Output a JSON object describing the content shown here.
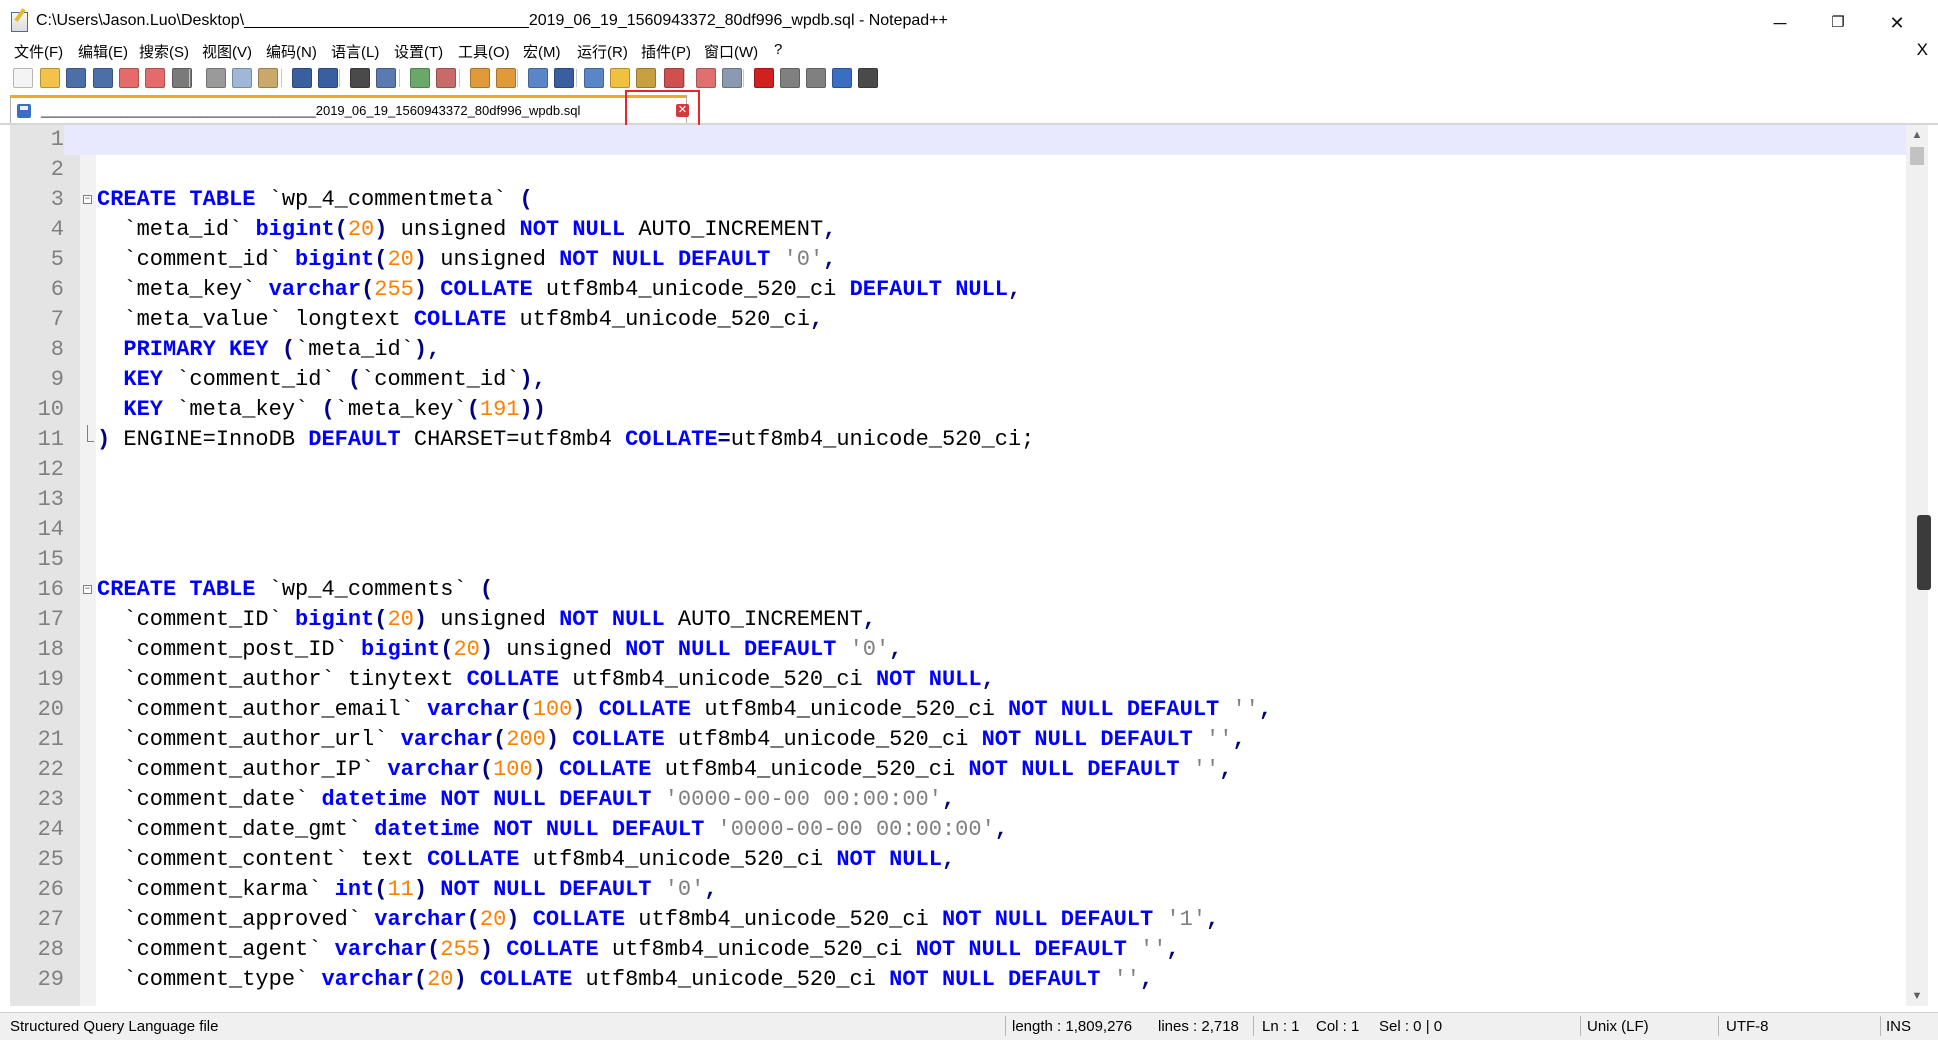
{
  "window": {
    "title": "C:\\Users\\Jason.Luo\\Desktop\\________________________________2019_06_19_1560943372_80df996_wpdb.sql - Notepad++",
    "minimize": "─",
    "restore": "❐",
    "close": "✕"
  },
  "menu": {
    "items": [
      "文件(F)",
      "编辑(E)",
      "搜索(S)",
      "视图(V)",
      "编码(N)",
      "语言(L)",
      "设置(T)",
      "工具(O)",
      "宏(M)",
      "运行(R)",
      "插件(P)",
      "窗口(W)",
      "?"
    ],
    "close": "X"
  },
  "toolbar": {
    "icons": [
      "new-file-icon",
      "open-file-icon",
      "save-icon",
      "save-all-icon",
      "close-icon",
      "close-all-icon",
      "print-icon",
      "cut-icon",
      "copy-icon",
      "paste-icon",
      "undo-icon",
      "redo-icon",
      "find-icon",
      "replace-icon",
      "zoom-in-icon",
      "zoom-out-icon",
      "sync-v-icon",
      "sync-h-icon",
      "word-wrap-icon",
      "show-all-chars-icon",
      "indent-guide-icon",
      "udl-icon",
      "doc-map-icon",
      "function-list-icon",
      "folder-workspace-icon",
      "monitor-icon",
      "record-macro-icon",
      "stop-macro-icon",
      "play-macro-icon",
      "run-macro-multiple-icon",
      "save-macro-icon"
    ]
  },
  "tab": {
    "label": "______________________________________2019_06_19_1560943372_80df996_wpdb.sql",
    "close": "✕"
  },
  "editor": {
    "current_line": 1,
    "lines": [
      {
        "n": "1",
        "tokens": []
      },
      {
        "n": "2",
        "tokens": []
      },
      {
        "n": "3",
        "fold": "start",
        "tokens": [
          [
            "kw",
            "CREATE"
          ],
          [
            "p",
            " "
          ],
          [
            "kw",
            "TABLE"
          ],
          [
            "p",
            " `wp_4_commentmeta` "
          ],
          [
            "op",
            "("
          ]
        ]
      },
      {
        "n": "4",
        "tokens": [
          [
            "p",
            "  `meta_id` "
          ],
          [
            "kw",
            "bigint"
          ],
          [
            "op",
            "("
          ],
          [
            "num",
            "20"
          ],
          [
            "op",
            ")"
          ],
          [
            "p",
            " unsigned "
          ],
          [
            "kw",
            "NOT"
          ],
          [
            "p",
            " "
          ],
          [
            "kw",
            "NULL"
          ],
          [
            "p",
            " AUTO_INCREMENT"
          ],
          [
            "op",
            ","
          ]
        ]
      },
      {
        "n": "5",
        "tokens": [
          [
            "p",
            "  `comment_id` "
          ],
          [
            "kw",
            "bigint"
          ],
          [
            "op",
            "("
          ],
          [
            "num",
            "20"
          ],
          [
            "op",
            ")"
          ],
          [
            "p",
            " unsigned "
          ],
          [
            "kw",
            "NOT"
          ],
          [
            "p",
            " "
          ],
          [
            "kw",
            "NULL"
          ],
          [
            "p",
            " "
          ],
          [
            "kw",
            "DEFAULT"
          ],
          [
            "p",
            " "
          ],
          [
            "str",
            "'0'"
          ],
          [
            "op",
            ","
          ]
        ]
      },
      {
        "n": "6",
        "tokens": [
          [
            "p",
            "  `meta_key` "
          ],
          [
            "kw",
            "varchar"
          ],
          [
            "op",
            "("
          ],
          [
            "num",
            "255"
          ],
          [
            "op",
            ")"
          ],
          [
            "p",
            " "
          ],
          [
            "kw",
            "COLLATE"
          ],
          [
            "p",
            " utf8mb4_unicode_520_ci "
          ],
          [
            "kw",
            "DEFAULT"
          ],
          [
            "p",
            " "
          ],
          [
            "kw",
            "NULL"
          ],
          [
            "op",
            ","
          ]
        ]
      },
      {
        "n": "7",
        "tokens": [
          [
            "p",
            "  `meta_value` longtext "
          ],
          [
            "kw",
            "COLLATE"
          ],
          [
            "p",
            " utf8mb4_unicode_520_ci"
          ],
          [
            "op",
            ","
          ]
        ]
      },
      {
        "n": "8",
        "tokens": [
          [
            "p",
            "  "
          ],
          [
            "kw",
            "PRIMARY"
          ],
          [
            "p",
            " "
          ],
          [
            "kw",
            "KEY"
          ],
          [
            "p",
            " "
          ],
          [
            "op",
            "("
          ],
          [
            "p",
            "`meta_id`"
          ],
          [
            "op",
            "),"
          ]
        ]
      },
      {
        "n": "9",
        "tokens": [
          [
            "p",
            "  "
          ],
          [
            "kw",
            "KEY"
          ],
          [
            "p",
            " `comment_id` "
          ],
          [
            "op",
            "("
          ],
          [
            "p",
            "`comment_id`"
          ],
          [
            "op",
            "),"
          ]
        ]
      },
      {
        "n": "10",
        "tokens": [
          [
            "p",
            "  "
          ],
          [
            "kw",
            "KEY"
          ],
          [
            "p",
            " `meta_key` "
          ],
          [
            "op",
            "("
          ],
          [
            "p",
            "`meta_key`"
          ],
          [
            "op",
            "("
          ],
          [
            "num",
            "191"
          ],
          [
            "op",
            "))"
          ]
        ]
      },
      {
        "n": "11",
        "fold": "end",
        "tokens": [
          [
            "op",
            ")"
          ],
          [
            "p",
            " ENGINE=InnoDB "
          ],
          [
            "kw",
            "DEFAULT"
          ],
          [
            "p",
            " CHARSET=utf8mb4 "
          ],
          [
            "kw",
            "COLLATE"
          ],
          [
            "op",
            "="
          ],
          [
            "p",
            "utf8mb4_unicode_520_ci;"
          ]
        ]
      },
      {
        "n": "12",
        "tokens": []
      },
      {
        "n": "13",
        "tokens": []
      },
      {
        "n": "14",
        "tokens": []
      },
      {
        "n": "15",
        "tokens": []
      },
      {
        "n": "16",
        "fold": "start",
        "tokens": [
          [
            "kw",
            "CREATE"
          ],
          [
            "p",
            " "
          ],
          [
            "kw",
            "TABLE"
          ],
          [
            "p",
            " `wp_4_comments` "
          ],
          [
            "op",
            "("
          ]
        ]
      },
      {
        "n": "17",
        "tokens": [
          [
            "p",
            "  `comment_ID` "
          ],
          [
            "kw",
            "bigint"
          ],
          [
            "op",
            "("
          ],
          [
            "num",
            "20"
          ],
          [
            "op",
            ")"
          ],
          [
            "p",
            " unsigned "
          ],
          [
            "kw",
            "NOT"
          ],
          [
            "p",
            " "
          ],
          [
            "kw",
            "NULL"
          ],
          [
            "p",
            " AUTO_INCREMENT"
          ],
          [
            "op",
            ","
          ]
        ]
      },
      {
        "n": "18",
        "tokens": [
          [
            "p",
            "  `comment_post_ID` "
          ],
          [
            "kw",
            "bigint"
          ],
          [
            "op",
            "("
          ],
          [
            "num",
            "20"
          ],
          [
            "op",
            ")"
          ],
          [
            "p",
            " unsigned "
          ],
          [
            "kw",
            "NOT"
          ],
          [
            "p",
            " "
          ],
          [
            "kw",
            "NULL"
          ],
          [
            "p",
            " "
          ],
          [
            "kw",
            "DEFAULT"
          ],
          [
            "p",
            " "
          ],
          [
            "str",
            "'0'"
          ],
          [
            "op",
            ","
          ]
        ]
      },
      {
        "n": "19",
        "tokens": [
          [
            "p",
            "  `comment_author` tinytext "
          ],
          [
            "kw",
            "COLLATE"
          ],
          [
            "p",
            " utf8mb4_unicode_520_ci "
          ],
          [
            "kw",
            "NOT"
          ],
          [
            "p",
            " "
          ],
          [
            "kw",
            "NULL"
          ],
          [
            "op",
            ","
          ]
        ]
      },
      {
        "n": "20",
        "tokens": [
          [
            "p",
            "  `comment_author_email` "
          ],
          [
            "kw",
            "varchar"
          ],
          [
            "op",
            "("
          ],
          [
            "num",
            "100"
          ],
          [
            "op",
            ")"
          ],
          [
            "p",
            " "
          ],
          [
            "kw",
            "COLLATE"
          ],
          [
            "p",
            " utf8mb4_unicode_520_ci "
          ],
          [
            "kw",
            "NOT"
          ],
          [
            "p",
            " "
          ],
          [
            "kw",
            "NULL"
          ],
          [
            "p",
            " "
          ],
          [
            "kw",
            "DEFAULT"
          ],
          [
            "p",
            " "
          ],
          [
            "str",
            "''"
          ],
          [
            "op",
            ","
          ]
        ]
      },
      {
        "n": "21",
        "tokens": [
          [
            "p",
            "  `comment_author_url` "
          ],
          [
            "kw",
            "varchar"
          ],
          [
            "op",
            "("
          ],
          [
            "num",
            "200"
          ],
          [
            "op",
            ")"
          ],
          [
            "p",
            " "
          ],
          [
            "kw",
            "COLLATE"
          ],
          [
            "p",
            " utf8mb4_unicode_520_ci "
          ],
          [
            "kw",
            "NOT"
          ],
          [
            "p",
            " "
          ],
          [
            "kw",
            "NULL"
          ],
          [
            "p",
            " "
          ],
          [
            "kw",
            "DEFAULT"
          ],
          [
            "p",
            " "
          ],
          [
            "str",
            "''"
          ],
          [
            "op",
            ","
          ]
        ]
      },
      {
        "n": "22",
        "tokens": [
          [
            "p",
            "  `comment_author_IP` "
          ],
          [
            "kw",
            "varchar"
          ],
          [
            "op",
            "("
          ],
          [
            "num",
            "100"
          ],
          [
            "op",
            ")"
          ],
          [
            "p",
            " "
          ],
          [
            "kw",
            "COLLATE"
          ],
          [
            "p",
            " utf8mb4_unicode_520_ci "
          ],
          [
            "kw",
            "NOT"
          ],
          [
            "p",
            " "
          ],
          [
            "kw",
            "NULL"
          ],
          [
            "p",
            " "
          ],
          [
            "kw",
            "DEFAULT"
          ],
          [
            "p",
            " "
          ],
          [
            "str",
            "''"
          ],
          [
            "op",
            ","
          ]
        ]
      },
      {
        "n": "23",
        "tokens": [
          [
            "p",
            "  `comment_date` "
          ],
          [
            "kw",
            "datetime"
          ],
          [
            "p",
            " "
          ],
          [
            "kw",
            "NOT"
          ],
          [
            "p",
            " "
          ],
          [
            "kw",
            "NULL"
          ],
          [
            "p",
            " "
          ],
          [
            "kw",
            "DEFAULT"
          ],
          [
            "p",
            " "
          ],
          [
            "str",
            "'0000-00-00 00:00:00'"
          ],
          [
            "op",
            ","
          ]
        ]
      },
      {
        "n": "24",
        "tokens": [
          [
            "p",
            "  `comment_date_gmt` "
          ],
          [
            "kw",
            "datetime"
          ],
          [
            "p",
            " "
          ],
          [
            "kw",
            "NOT"
          ],
          [
            "p",
            " "
          ],
          [
            "kw",
            "NULL"
          ],
          [
            "p",
            " "
          ],
          [
            "kw",
            "DEFAULT"
          ],
          [
            "p",
            " "
          ],
          [
            "str",
            "'0000-00-00 00:00:00'"
          ],
          [
            "op",
            ","
          ]
        ]
      },
      {
        "n": "25",
        "tokens": [
          [
            "p",
            "  `comment_content` text "
          ],
          [
            "kw",
            "COLLATE"
          ],
          [
            "p",
            " utf8mb4_unicode_520_ci "
          ],
          [
            "kw",
            "NOT"
          ],
          [
            "p",
            " "
          ],
          [
            "kw",
            "NULL"
          ],
          [
            "op",
            ","
          ]
        ]
      },
      {
        "n": "26",
        "tokens": [
          [
            "p",
            "  `comment_karma` "
          ],
          [
            "kw",
            "int"
          ],
          [
            "op",
            "("
          ],
          [
            "num",
            "11"
          ],
          [
            "op",
            ")"
          ],
          [
            "p",
            " "
          ],
          [
            "kw",
            "NOT"
          ],
          [
            "p",
            " "
          ],
          [
            "kw",
            "NULL"
          ],
          [
            "p",
            " "
          ],
          [
            "kw",
            "DEFAULT"
          ],
          [
            "p",
            " "
          ],
          [
            "str",
            "'0'"
          ],
          [
            "op",
            ","
          ]
        ]
      },
      {
        "n": "27",
        "tokens": [
          [
            "p",
            "  `comment_approved` "
          ],
          [
            "kw",
            "varchar"
          ],
          [
            "op",
            "("
          ],
          [
            "num",
            "20"
          ],
          [
            "op",
            ")"
          ],
          [
            "p",
            " "
          ],
          [
            "kw",
            "COLLATE"
          ],
          [
            "p",
            " utf8mb4_unicode_520_ci "
          ],
          [
            "kw",
            "NOT"
          ],
          [
            "p",
            " "
          ],
          [
            "kw",
            "NULL"
          ],
          [
            "p",
            " "
          ],
          [
            "kw",
            "DEFAULT"
          ],
          [
            "p",
            " "
          ],
          [
            "str",
            "'1'"
          ],
          [
            "op",
            ","
          ]
        ]
      },
      {
        "n": "28",
        "tokens": [
          [
            "p",
            "  `comment_agent` "
          ],
          [
            "kw",
            "varchar"
          ],
          [
            "op",
            "("
          ],
          [
            "num",
            "255"
          ],
          [
            "op",
            ")"
          ],
          [
            "p",
            " "
          ],
          [
            "kw",
            "COLLATE"
          ],
          [
            "p",
            " utf8mb4_unicode_520_ci "
          ],
          [
            "kw",
            "NOT"
          ],
          [
            "p",
            " "
          ],
          [
            "kw",
            "NULL"
          ],
          [
            "p",
            " "
          ],
          [
            "kw",
            "DEFAULT"
          ],
          [
            "p",
            " "
          ],
          [
            "str",
            "''"
          ],
          [
            "op",
            ","
          ]
        ]
      },
      {
        "n": "29",
        "tokens": [
          [
            "p",
            "  `comment_type` "
          ],
          [
            "kw",
            "varchar"
          ],
          [
            "op",
            "("
          ],
          [
            "num",
            "20"
          ],
          [
            "op",
            ")"
          ],
          [
            "p",
            " "
          ],
          [
            "kw",
            "COLLATE"
          ],
          [
            "p",
            " utf8mb4_unicode_520_ci "
          ],
          [
            "kw",
            "NOT"
          ],
          [
            "p",
            " "
          ],
          [
            "kw",
            "NULL"
          ],
          [
            "p",
            " "
          ],
          [
            "kw",
            "DEFAULT"
          ],
          [
            "p",
            " "
          ],
          [
            "str",
            "''"
          ],
          [
            "op",
            ","
          ]
        ]
      }
    ]
  },
  "status": {
    "file_type": "Structured Query Language file",
    "length": "length : 1,809,276",
    "lines": "lines : 2,718",
    "ln": "Ln : 1",
    "col": "Col : 1",
    "sel": "Sel : 0 | 0",
    "eol": "Unix (LF)",
    "encoding": "UTF-8",
    "mode": "INS"
  },
  "colors": {
    "keyword": "#0000ff",
    "number": "#ff8000",
    "string": "#808080",
    "operator": "#000080",
    "current_line": "#e8e8ff",
    "tab_accent": "#f5a623",
    "highlight_box": "#e3272b"
  }
}
